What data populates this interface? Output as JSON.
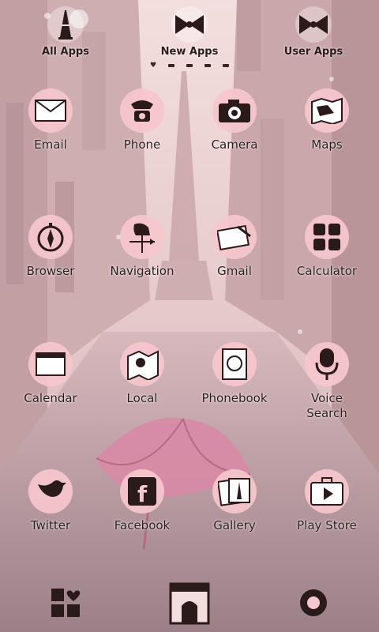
{
  "tabs": [
    {
      "label": "All Apps",
      "icon": "eiffel-tower-icon"
    },
    {
      "label": "New Apps",
      "icon": "bow-icon"
    },
    {
      "label": "User Apps",
      "icon": "bow-icon"
    }
  ],
  "page_indicator": {
    "current": 1,
    "total": 5
  },
  "apps": [
    {
      "label": "Email",
      "icon": "envelope-icon"
    },
    {
      "label": "Phone",
      "icon": "rotary-phone-icon"
    },
    {
      "label": "Camera",
      "icon": "camera-icon"
    },
    {
      "label": "Maps",
      "icon": "map-icon"
    },
    {
      "label": "Browser",
      "icon": "compass-icon"
    },
    {
      "label": "Navigation",
      "icon": "weathervane-icon"
    },
    {
      "label": "Gmail",
      "icon": "letter-icon"
    },
    {
      "label": "Calculator",
      "icon": "calculator-icon"
    },
    {
      "label": "Calendar",
      "icon": "calendar-icon"
    },
    {
      "label": "Local",
      "icon": "local-icon"
    },
    {
      "label": "Phonebook",
      "icon": "phonebook-icon"
    },
    {
      "label": "Voice\nSearch",
      "icon": "microphone-icon"
    },
    {
      "label": "Twitter",
      "icon": "bird-icon"
    },
    {
      "label": "Facebook",
      "icon": "facebook-icon"
    },
    {
      "label": "Gallery",
      "icon": "photos-icon"
    },
    {
      "label": "Play Store",
      "icon": "suitcase-play-icon"
    }
  ],
  "dock": [
    {
      "icon": "app-grid-heart-icon"
    },
    {
      "icon": "arc-de-triomphe-icon"
    },
    {
      "icon": "settings-gear-icon"
    }
  ],
  "colors": {
    "icon_circle": "#f6c7cc",
    "icon_ink": "#2b1a1a",
    "tint": "#e8c2c2"
  }
}
